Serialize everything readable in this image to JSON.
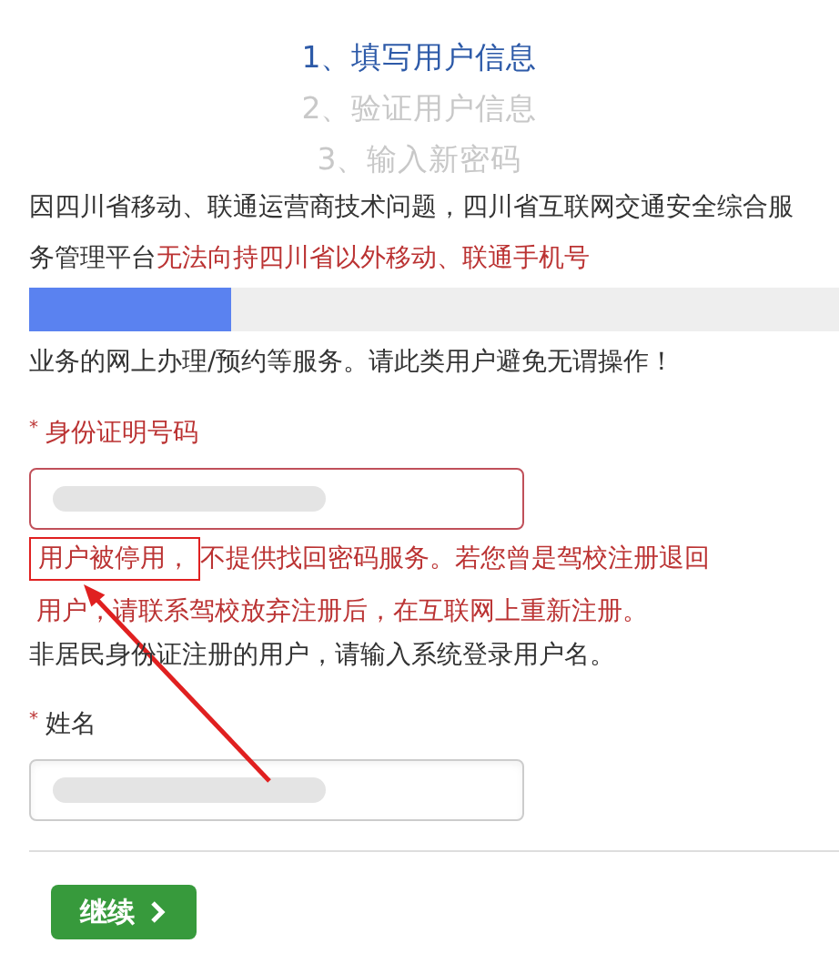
{
  "steps": [
    {
      "label": "1、填写用户信息",
      "selected": true
    },
    {
      "label": "2、验证用户信息",
      "selected": false
    },
    {
      "label": "3、输入新密码",
      "selected": false
    }
  ],
  "notice": {
    "text_before": "因四川省移动、联通运营商技术问题，四川省互联网交通安全综合服务管理平台",
    "text_red": "无法向持四川省以外移动、联通手机号",
    "level": 0.25,
    "text_after": "业务的网上办理/预约等服务。请此类用户避免无谓操作！"
  },
  "fields": [
    {
      "label": "身份证明号码",
      "marker": "*",
      "error": true,
      "error_highlight": "用户被停用，",
      "error_lines": [
        "不提供找回密码服务。若您曾是驾校注册退回",
        "用户，请联系驾校放弃注册后，在互联网上重新注册。"
      ],
      "hint": "非居民身份证注册的用户，请输入系统登录用户名。"
    },
    {
      "label": "姓名",
      "marker": "*",
      "error": false
    }
  ],
  "button": {
    "label": "继续"
  }
}
